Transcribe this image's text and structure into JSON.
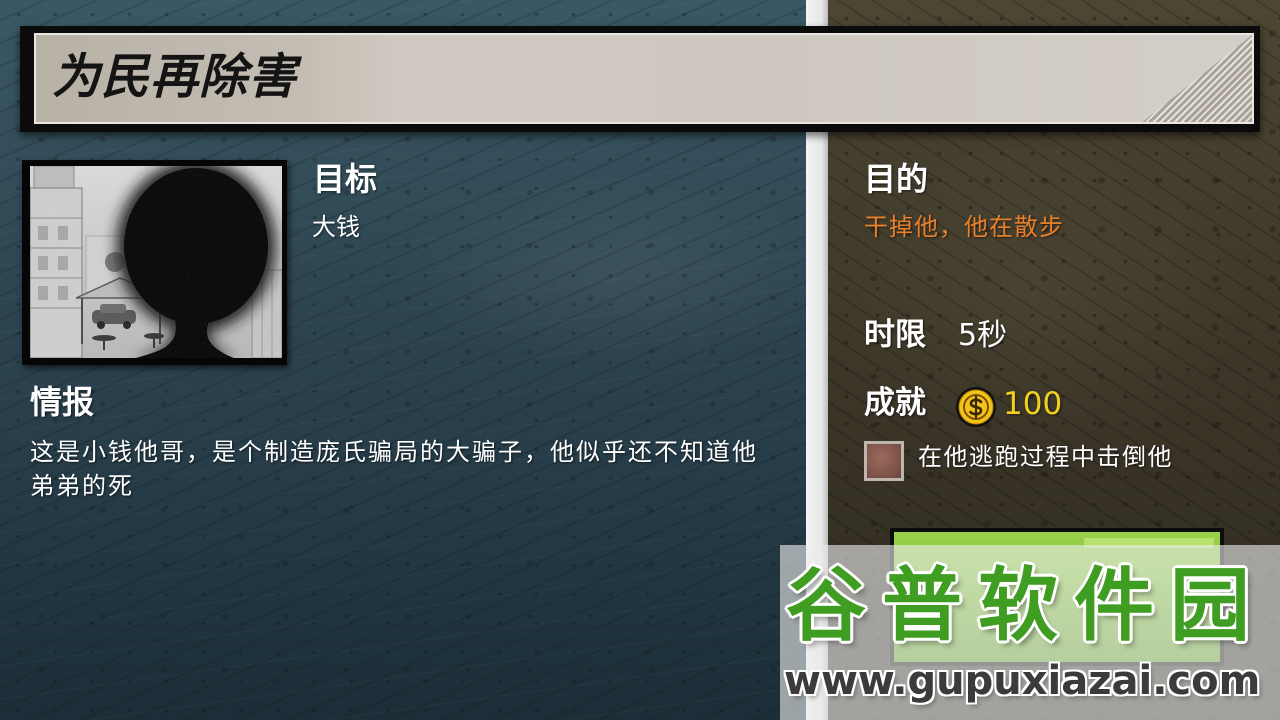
{
  "mission": {
    "title": "为民再除害",
    "target_label": "目标",
    "target_name": "大钱",
    "intel_label": "情报",
    "intel_text": "这是小钱他哥，是个制造庞氏骗局的大骗子，他似乎还不知道他弟弟的死"
  },
  "objective": {
    "label": "目的",
    "text": "干掉他，他在散步",
    "time_limit_label": "时限",
    "time_limit_value": "5秒",
    "achievement_label": "成就",
    "reward_icon": "coin-icon",
    "reward_value": "100",
    "achievement_icon": "achievement-badge-icon",
    "achievement_text": "在他逃跑过程中击倒他"
  },
  "watermark": {
    "brand": "谷普软件园",
    "url": "www.gupuxiazai.com"
  },
  "colors": {
    "objective_text": "#e8802b",
    "reward_value": "#f2cf1d",
    "action_button": "#7cbd2f",
    "watermark_brand": "#3f9d21",
    "watermark_url": "#3b3b3b"
  }
}
